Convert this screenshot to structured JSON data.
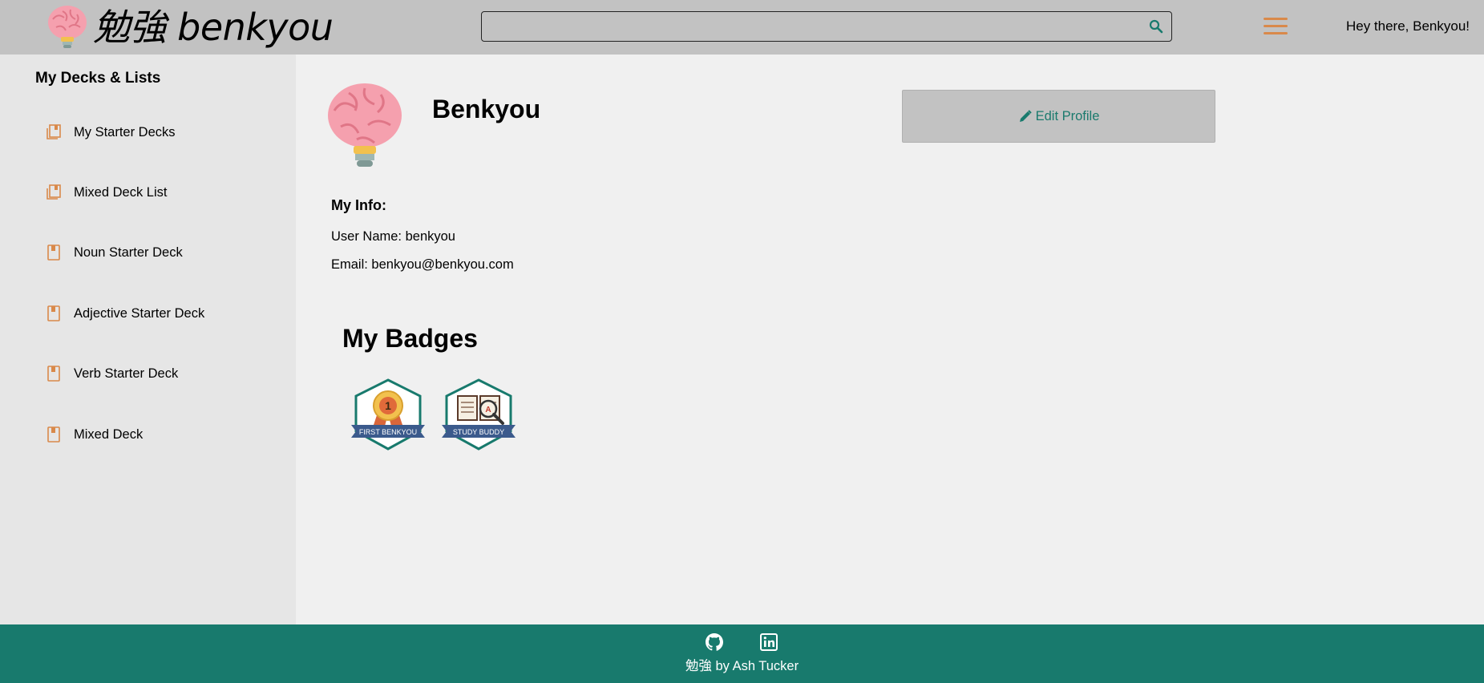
{
  "header": {
    "logo_text": "勉強 benkyou",
    "search": {
      "value": "",
      "placeholder": ""
    },
    "greeting": "Hey there, Benkyou!",
    "icons": {
      "logo": "brain-lightbulb-icon",
      "search": "search-icon",
      "menu": "hamburger-menu-icon"
    }
  },
  "sidebar": {
    "title": "My Decks & Lists",
    "items": [
      {
        "label": "My Starter Decks",
        "icon": "deck-stack-icon"
      },
      {
        "label": "Mixed Deck List",
        "icon": "deck-stack-icon"
      },
      {
        "label": "Noun Starter Deck",
        "icon": "deck-icon"
      },
      {
        "label": "Adjective Starter Deck",
        "icon": "deck-icon"
      },
      {
        "label": "Verb Starter Deck",
        "icon": "deck-icon"
      },
      {
        "label": "Mixed Deck",
        "icon": "deck-icon"
      }
    ]
  },
  "profile": {
    "name": "Benkyou",
    "edit_label": "Edit Profile",
    "info_heading": "My Info:",
    "user_name": "User Name: benkyou",
    "email": "Email: benkyou@benkyou.com"
  },
  "badges": {
    "heading": "My Badges",
    "items": [
      {
        "label": "FIRST BENKYOU",
        "emblem_text": "1",
        "icon": "first-benkyou-badge-icon"
      },
      {
        "label": "STUDY BUDDY",
        "emblem_text": "A",
        "icon": "study-buddy-badge-icon"
      }
    ]
  },
  "footer": {
    "text": "勉強 by Ash Tucker",
    "icons": [
      "github-icon",
      "linkedin-icon"
    ]
  },
  "colors": {
    "header_bg": "#c2c2c2",
    "sidebar_bg": "#e6e6e6",
    "main_bg": "#f0f0f0",
    "accent_teal": "#187a6d",
    "accent_orange": "#d9894a",
    "brain_pink": "#f5a0ae"
  }
}
